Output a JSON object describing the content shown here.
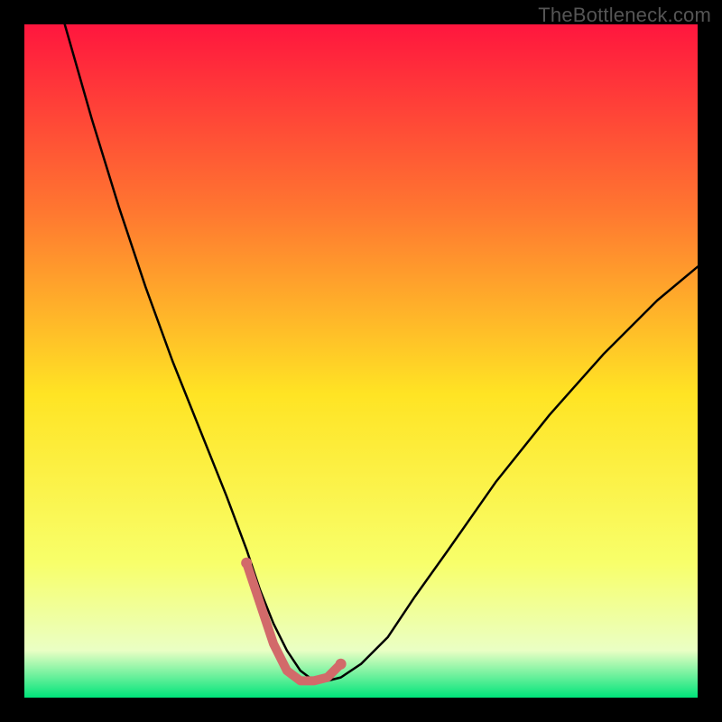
{
  "watermark": "TheBottleneck.com",
  "chart_data": {
    "type": "line",
    "title": "",
    "xlabel": "",
    "ylabel": "",
    "xlim": [
      0,
      100
    ],
    "ylim": [
      0,
      100
    ],
    "background_gradient": {
      "top": "#ff163e",
      "upper_mid": "#ff7830",
      "mid": "#ffe424",
      "lower_mid": "#f8ff6a",
      "near_bottom": "#eaffc4",
      "bottom": "#00e47a"
    },
    "series": [
      {
        "name": "bottleneck-curve",
        "color": "#000000",
        "width": 2.5,
        "x": [
          6,
          10,
          14,
          18,
          22,
          26,
          30,
          33,
          35,
          37,
          39,
          41,
          43,
          45,
          47,
          50,
          54,
          58,
          63,
          70,
          78,
          86,
          94,
          100
        ],
        "values": [
          100,
          86,
          73,
          61,
          50,
          40,
          30,
          22,
          16,
          11,
          7,
          4,
          2.5,
          2.5,
          3,
          5,
          9,
          15,
          22,
          32,
          42,
          51,
          59,
          64
        ]
      },
      {
        "name": "highlight-segment",
        "color": "#d26a6a",
        "width": 10,
        "x": [
          33,
          35,
          37,
          39,
          41,
          43,
          45,
          47
        ],
        "values": [
          20,
          14,
          8,
          4,
          2.5,
          2.5,
          3,
          5
        ]
      }
    ],
    "highlight_endpoints": {
      "color": "#d26a6a",
      "radius": 6,
      "points": [
        {
          "x": 33,
          "y": 20
        },
        {
          "x": 47,
          "y": 5
        }
      ]
    }
  }
}
